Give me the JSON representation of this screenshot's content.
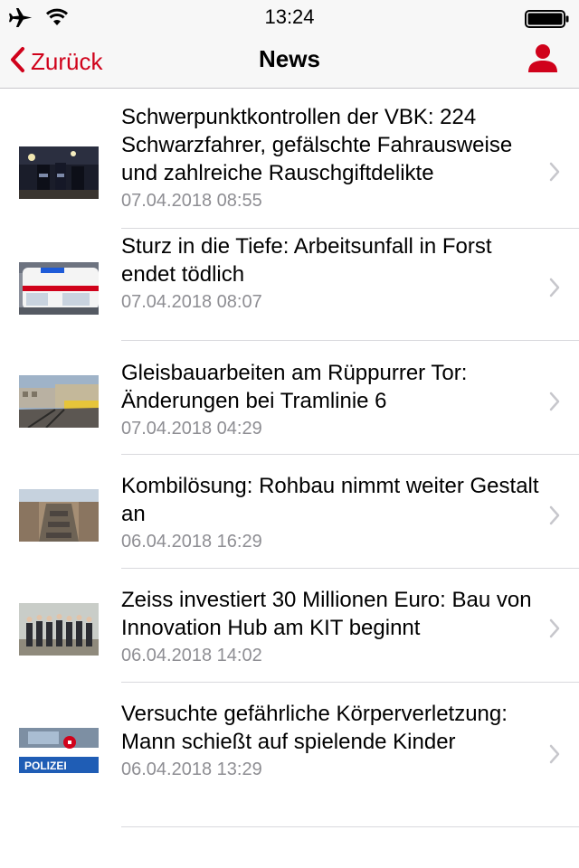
{
  "status_bar": {
    "time": "13:24",
    "icons": [
      "airplane-icon",
      "wifi-icon",
      "battery-icon"
    ]
  },
  "nav": {
    "back_label": "Zurück",
    "title": "News",
    "profile_icon": "person-icon",
    "accent_color": "#d0021b"
  },
  "news": [
    {
      "title": "Schwerpunktkontrollen der VBK: 224 Schwarzfahrer, gefälschte Fahrausweise und zahlreiche Rauschgiftdelikte",
      "date": "07.04.2018 08:55",
      "thumb": "photo-police-night"
    },
    {
      "title": "Sturz in die Tiefe: Arbeitsunfall in Forst endet tödlich",
      "date": "07.04.2018 08:07",
      "thumb": "photo-ambulance"
    },
    {
      "title": "Gleisbauarbeiten am Rüppurrer Tor: Änderungen bei Tramlinie 6",
      "date": "07.04.2018 04:29",
      "thumb": "photo-tram"
    },
    {
      "title": "Kombilösung: Rohbau nimmt weiter Gestalt an",
      "date": "06.04.2018 16:29",
      "thumb": "photo-construction"
    },
    {
      "title": "Zeiss investiert 30 Millionen Euro: Bau von Innovation Hub am KIT beginnt",
      "date": "06.04.2018 14:02",
      "thumb": "photo-group"
    },
    {
      "title": "Versuchte gefährliche Körperverletzung: Mann schießt auf spielende Kinder",
      "date": "06.04.2018 13:29",
      "thumb": "photo-polizei-car",
      "thumb_text": "POLIZEI"
    }
  ]
}
